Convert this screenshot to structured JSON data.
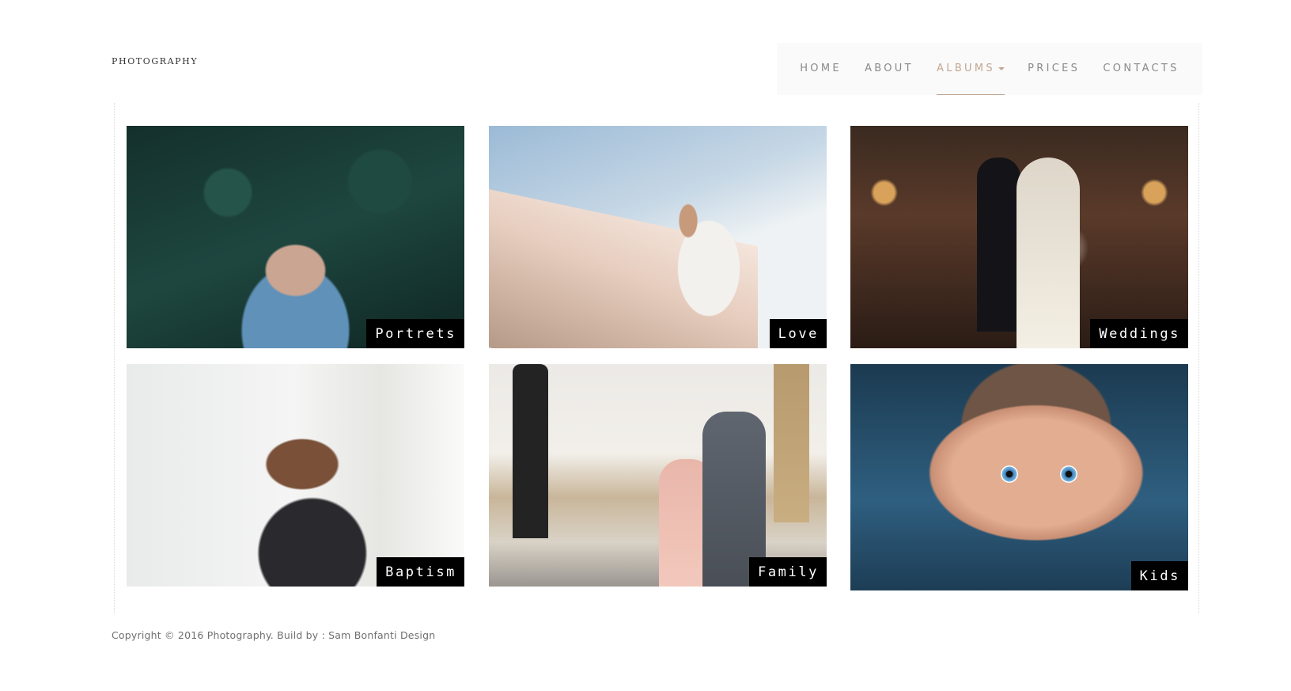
{
  "logo": "PHOTOGRAPHY",
  "nav": {
    "items": [
      {
        "label": "HOME"
      },
      {
        "label": "ABOUT"
      },
      {
        "label": "ALBUMS"
      },
      {
        "label": "PRICES"
      },
      {
        "label": "CONTACTS"
      }
    ]
  },
  "albums": [
    {
      "label": "Portrets"
    },
    {
      "label": "Love"
    },
    {
      "label": "Weddings"
    },
    {
      "label": "Baptism"
    },
    {
      "label": "Family"
    },
    {
      "label": "Kids"
    }
  ],
  "footer": {
    "copyright": "Copyright © 2016 Photography. Build by : Sam Bonfanti Design"
  },
  "colors": {
    "nav_active": "#c2a692",
    "nav_text": "#8a8a8a",
    "label_bg": "#000000"
  }
}
